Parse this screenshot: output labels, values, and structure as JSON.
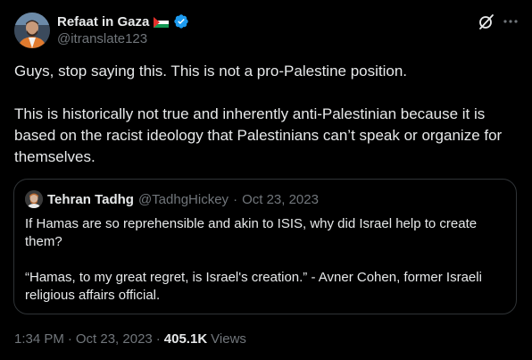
{
  "author": {
    "display_name": "Refaat in Gaza",
    "handle": "@itranslate123",
    "flag": "palestine-flag",
    "verified": true
  },
  "tweet": {
    "paragraphs": [
      "Guys, stop saying this. This is not a pro-Palestine position.",
      "This is historically not true and inherently anti-Palestinian because it is based on the racist ideology that Palestinians can’t speak or organize for themselves."
    ]
  },
  "quoted": {
    "display_name": "Tehran Tadhg",
    "handle": "@TadhgHickey",
    "separator": "·",
    "date": "Oct 23, 2023",
    "paragraphs": [
      "If Hamas are so reprehensible and akin to ISIS, why did Israel help to create them?",
      "“Hamas, to my great regret, is Israel's creation.” - Avner Cohen, former Israeli religious affairs official."
    ]
  },
  "footer": {
    "time": "1:34 PM",
    "separator": "·",
    "date": "Oct 23, 2023",
    "views_count": "405.1K",
    "views_label": "Views"
  },
  "icons": {
    "grok": "grok-icon",
    "more": "more-icon"
  },
  "colors": {
    "background": "#000000",
    "text": "#e7e9ea",
    "muted": "#71767b",
    "border": "#2f3336",
    "verified": "#1d9bf0"
  }
}
